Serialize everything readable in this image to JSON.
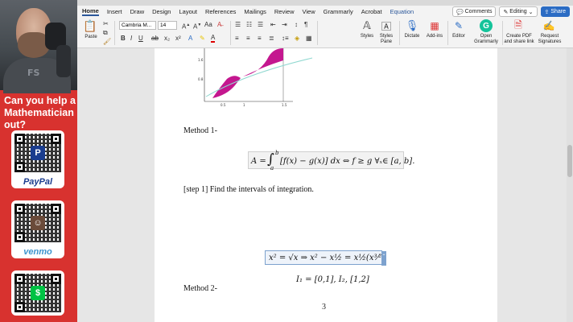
{
  "left_panel": {
    "shirt_text": "FS",
    "headline": "Can you help a Mathematician out?",
    "payments": [
      {
        "label": "PayPal",
        "color": "#1b3d8f",
        "logo": "P"
      },
      {
        "label": "venmo",
        "color": "#3d95ce",
        "logo": "☺"
      },
      {
        "label": "",
        "color": "#00c244",
        "logo": "$"
      }
    ]
  },
  "menu": {
    "tabs": [
      "Home",
      "Insert",
      "Draw",
      "Design",
      "Layout",
      "References",
      "Mailings",
      "Review",
      "View",
      "Grammarly",
      "Acrobat",
      "Equation"
    ],
    "comments": "Comments",
    "editing": "Editing",
    "share": "Share"
  },
  "ribbon": {
    "paste": "Paste",
    "font_name": "Cambria M...",
    "font_size": "14",
    "styles": "Styles",
    "styles_pane": "Styles Pane",
    "dictate": "Dictate",
    "addins": "Add-ins",
    "editor": "Editor",
    "grammarly": "Open Grammarly",
    "create_pdf": "Create PDF and share link",
    "request_sig": "Request Signatures"
  },
  "document": {
    "plot_ticks_y": [
      "1.6",
      "0.8"
    ],
    "plot_ticks_x": [
      "0.5",
      "1",
      "1.5"
    ],
    "method1": "Method 1-",
    "area_formula_lhs": "A =",
    "area_integral": "∫",
    "area_upper": "b",
    "area_lower": "a",
    "area_formula_rhs": "[f(x) − g(x)] dx ⇔ f ≥ g ∀ₓ∈ [a, b].",
    "step1": "[step 1] Find the intervals of integration.",
    "equation_edit": "x² = √x  ⇒  x² − x½ = x½(x³⁄²0",
    "intervals": "I₁ = [0,1], I₂, [1,2]",
    "method2": "Method 2-",
    "page_number": "3"
  },
  "colors": {
    "panel_red": "#d8322f",
    "word_blue": "#2b579a",
    "fill_magenta": "#c4178f",
    "curve_cyan": "#8fd8d0"
  }
}
